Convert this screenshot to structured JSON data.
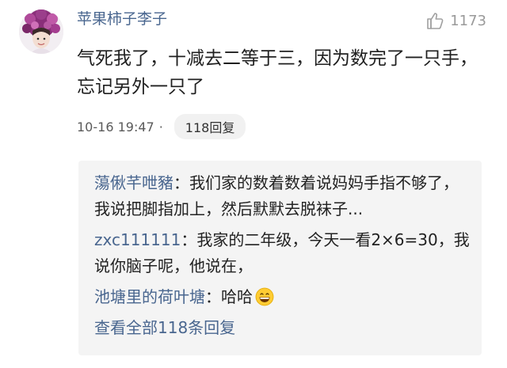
{
  "comment": {
    "username": "苹果柿子李子",
    "like_count": "1173",
    "text": "气死我了，十减去二等于三，因为数完了一只手，忘记另外一只了",
    "timestamp": "10-16 19:47",
    "separator": "·",
    "reply_count_label": "118回复",
    "icons": {
      "avatar": "avatar-flowers",
      "like": "thumbs-up-icon"
    },
    "colors": {
      "link": "#49668f",
      "text": "#1f1f1f",
      "reply_box_bg": "#f4f4f4"
    }
  },
  "replies": [
    {
      "name": "蕩偢芊呭豬",
      "separator": "：",
      "text": "我们家的数着数着说妈妈手指不够了，我说把脚指加上，然后默默去脱袜子..."
    },
    {
      "name": "zxc111111",
      "separator": "：",
      "text": "我家的二年级，今天一看2×6=30，我说你脑子呢，他说在，"
    },
    {
      "name": "池塘里的荷叶塘",
      "separator": "：",
      "text": "哈哈",
      "emoji": "grinning-face-emoji"
    }
  ],
  "view_all_label": "查看全部118条回复"
}
